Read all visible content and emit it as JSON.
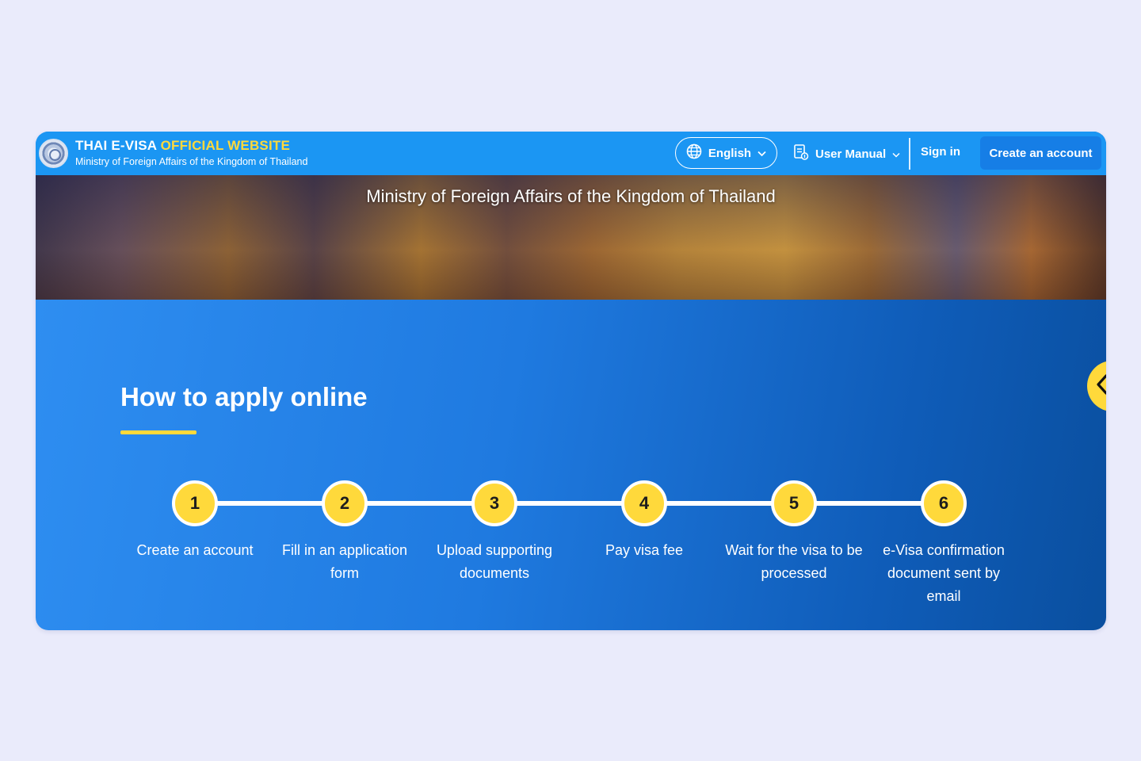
{
  "header": {
    "brand_title_main": "THAI E-VISA ",
    "brand_title_highlight": "OFFICIAL WEBSITE",
    "brand_subtitle": "Ministry of Foreign Affairs of the Kingdom of Thailand",
    "language_label": "English",
    "user_manual_label": "User Manual",
    "sign_in_label": "Sign in",
    "create_account_label": "Create an account"
  },
  "banner": {
    "title": "Ministry of Foreign Affairs of the Kingdom of Thailand"
  },
  "main": {
    "section_title": "How to apply online",
    "steps": [
      {
        "number": "1",
        "label": "Create an account"
      },
      {
        "number": "2",
        "label": "Fill in an application form"
      },
      {
        "number": "3",
        "label": "Upload supporting documents"
      },
      {
        "number": "4",
        "label": "Pay visa fee"
      },
      {
        "number": "5",
        "label": "Wait for the visa to be processed"
      },
      {
        "number": "6",
        "label": "e-Visa confirmation document sent by email"
      }
    ]
  },
  "icons": {
    "logo": "ministry-seal-logo",
    "language": "globe-icon",
    "dropdown": "chevron-down-icon",
    "manual": "document-icon",
    "side_tab": "chevron-left-icon"
  },
  "colors": {
    "header_bg": "#1b96f3",
    "accent_yellow": "#ffd93b",
    "button_blue": "#167ee6",
    "content_gradient_start": "#2f8ff2",
    "content_gradient_end": "#0a4f9f"
  }
}
